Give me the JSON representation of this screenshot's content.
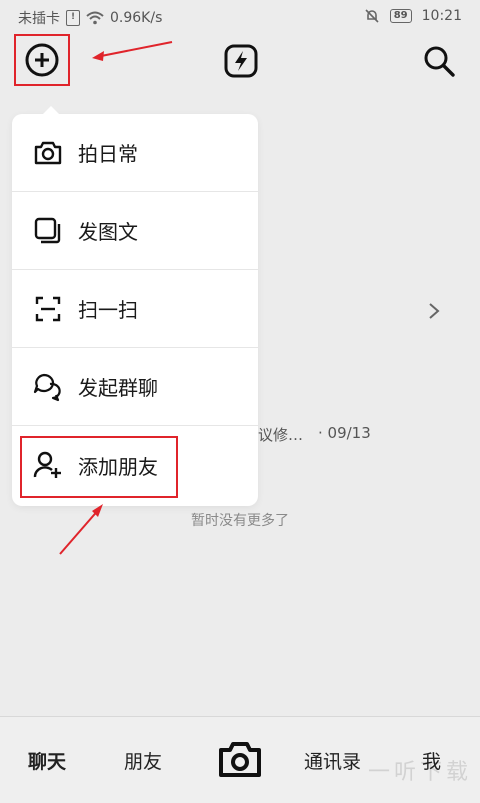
{
  "status_bar": {
    "carrier": "未插卡",
    "net_speed": "0.96K/s",
    "battery": "89",
    "time": "10:21"
  },
  "top_bar": {
    "icons": [
      "plus-circle-icon",
      "flash-icon",
      "search-icon"
    ]
  },
  "menu": {
    "items": [
      {
        "label": "拍日常",
        "icon": "camera-icon"
      },
      {
        "label": "发图文",
        "icon": "gallery-icon"
      },
      {
        "label": "扫一扫",
        "icon": "scan-icon"
      },
      {
        "label": "发起群聊",
        "icon": "group-chat-icon"
      },
      {
        "label": "添加朋友",
        "icon": "add-friend-icon"
      }
    ]
  },
  "background": {
    "snippet": "议修…",
    "date": "· 09/13",
    "no_more": "暂时没有更多了"
  },
  "bottom_nav": {
    "chat": "聊天",
    "friends": "朋友",
    "messages": "通讯录",
    "me": "我"
  },
  "watermark": "一听下载",
  "colors": {
    "highlight": "#e0242b",
    "background": "#ececec",
    "menu": "#ffffff"
  }
}
